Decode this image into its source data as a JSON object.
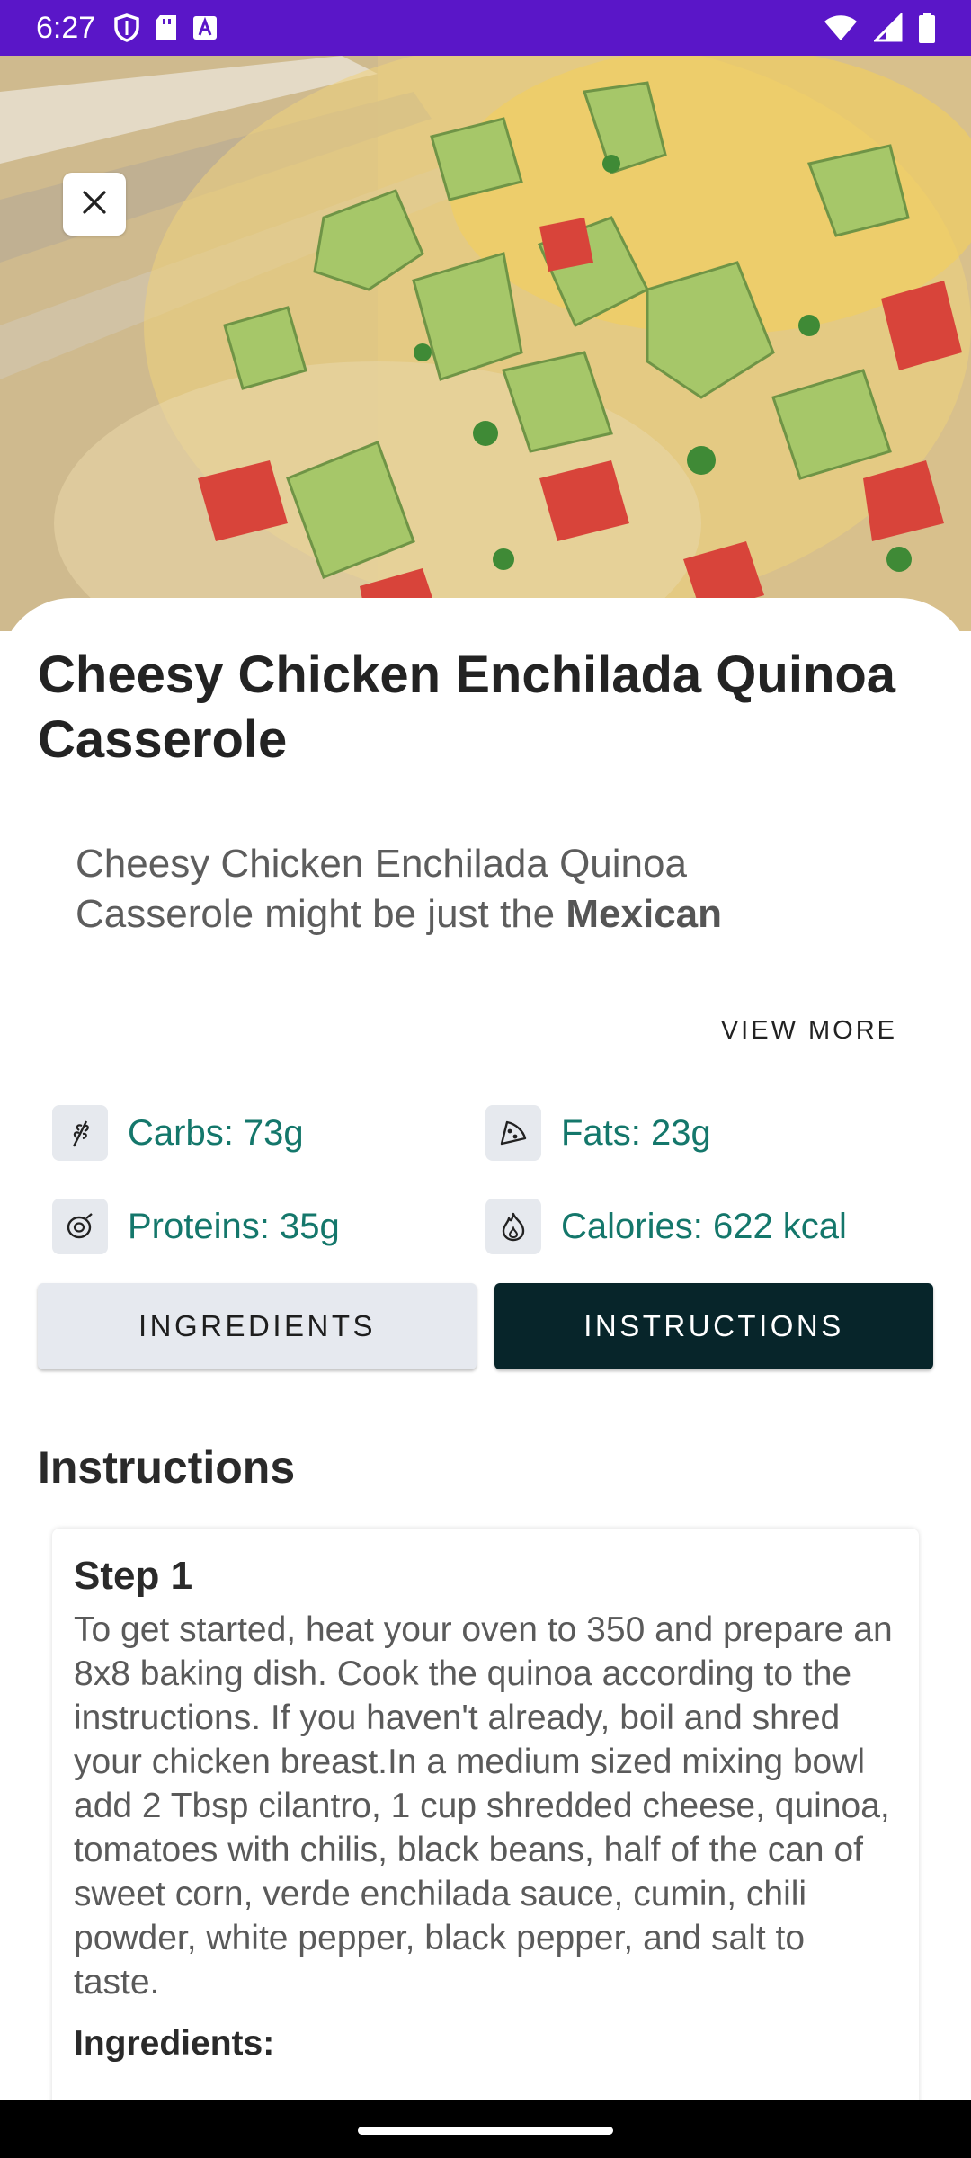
{
  "status_bar": {
    "time": "6:27",
    "left_icons": [
      "shield-icon",
      "sd-card-icon",
      "font-a-icon"
    ],
    "right_icons": [
      "wifi-icon",
      "signal-icon",
      "battery-icon"
    ],
    "background": "#5a16c8"
  },
  "recipe": {
    "title": "Cheesy Chicken Enchilada Quinoa Casserole",
    "description_plain": "Cheesy Chicken Enchilada Quinoa Casserole might be just the",
    "description_bold": "Mexican",
    "view_more_label": "VIEW MORE"
  },
  "nutrition": [
    {
      "icon": "wheat-icon",
      "label": "Carbs: 73g"
    },
    {
      "icon": "pizza-slice-icon",
      "label": "Fats: 23g"
    },
    {
      "icon": "protein-icon",
      "label": "Proteins: 35g"
    },
    {
      "icon": "flame-icon",
      "label": "Calories: 622 kcal"
    }
  ],
  "tabs": {
    "ingredients_label": "INGREDIENTS",
    "instructions_label": "INSTRUCTIONS",
    "selected": "INSTRUCTIONS"
  },
  "instructions": {
    "heading": "Instructions",
    "steps": [
      {
        "title": "Step 1",
        "text": "To get started, heat your oven to 350 and prepare an 8x8 baking dish. Cook the quinoa according to the instructions. If you haven't already, boil and shred your chicken breast.In a medium sized mixing bowl add 2 Tbsp cilantro, 1 cup shredded cheese, quinoa, tomatoes with chilis, black beans, half of the can of sweet corn, verde enchilada sauce, cumin, chili powder, white pepper, black pepper, and salt to taste.",
        "ingredients_label": "Ingredients:"
      }
    ]
  },
  "colors": {
    "accent_teal": "#14776b",
    "instructions_tab_bg": "#07252a",
    "ingredients_tab_bg": "#e6e9ef"
  }
}
